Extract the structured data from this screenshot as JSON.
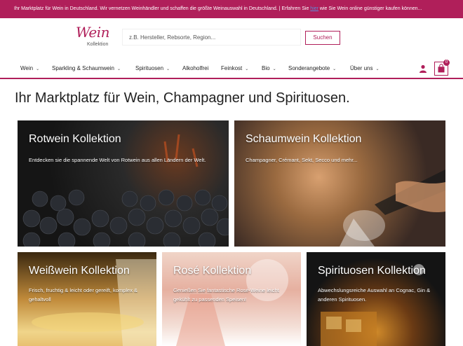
{
  "topbar": {
    "text_before": "Ihr Marktplatz für Wein in Deutschland. Wir vernetzen Weinhändler und schaffen die größte Weinauswahl in Deutschland. | Erfahren Sie ",
    "link": "hier",
    "text_after": " wie Sie Wein online günstiger kaufen können..."
  },
  "header": {
    "logo_main": "Wein",
    "logo_sub": "Kollektion",
    "search_placeholder": "z.B. Hersteller, Rebsorte, Region...",
    "search_button": "Suchen"
  },
  "nav": {
    "items": [
      {
        "label": "Wein"
      },
      {
        "label": "Sparkling & Schaumwein"
      },
      {
        "label": "Spirituosen"
      },
      {
        "label": "Alkoholfrei"
      },
      {
        "label": "Feinkost"
      },
      {
        "label": "Bio"
      },
      {
        "label": "Sonderangebote"
      },
      {
        "label": "Über uns"
      }
    ],
    "cart_count": "0"
  },
  "main": {
    "title": "Ihr Marktplatz für Wein, Champagner und Spirituosen.",
    "tiles": [
      {
        "title": "Rotwein Kollektion",
        "desc": "Entdecken sie die spannende Welt von Rotwein aus allen Ländern der Welt."
      },
      {
        "title": "Schaumwein Kollektion",
        "desc": "Champagner, Crémant, Sekt, Secco und mehr..."
      },
      {
        "title": "Weißwein Kollektion",
        "desc": "Frisch, fruchtig & leicht oder gereift, komplex & gehaltvoll"
      },
      {
        "title": "Rosé Kollektion",
        "desc": "Genießen Sie fantastische Rosé-Weine leicht gekühlt zu passenden Speisen!"
      },
      {
        "title": "Spirituosen Kollektion",
        "desc": "Abwechslungsreiche Auswahl an Cognac, Gin & anderen Spirituosen."
      }
    ]
  },
  "colors": {
    "brand": "#b01f5a",
    "link": "#5b8dd9"
  },
  "icons": {
    "user": "user-icon",
    "cart": "shopping-bag-icon",
    "chevron": "chevron-down-icon"
  }
}
